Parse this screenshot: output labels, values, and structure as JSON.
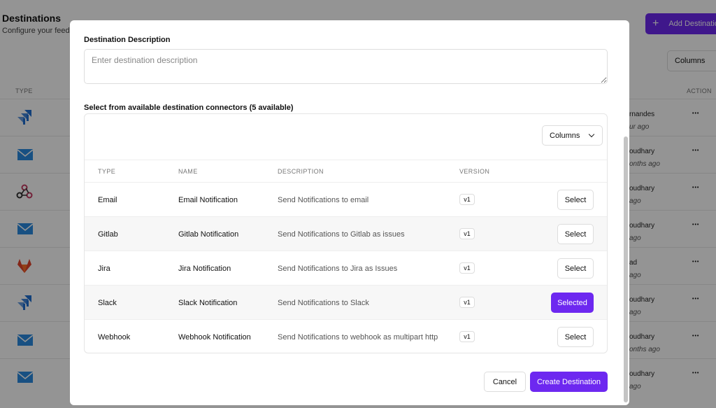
{
  "background": {
    "title": "Destinations",
    "subtitle": "Configure your feedba",
    "add_button": "Add Destinatio",
    "columns_button": "Columns",
    "col_type": "TYPE",
    "col_action": "ACTION",
    "rows": [
      {
        "icon": "jira-icon",
        "author": "rnandes",
        "ago": "ur ago"
      },
      {
        "icon": "email-icon",
        "author": "oudhary",
        "ago": "onths ago"
      },
      {
        "icon": "webhook-icon",
        "author": "oudhary",
        "ago": "ago"
      },
      {
        "icon": "email-icon",
        "author": "oudhary",
        "ago": "ago"
      },
      {
        "icon": "gitlab-icon",
        "author": "ad",
        "ago": "ago"
      },
      {
        "icon": "jira-icon",
        "author": "oudhary",
        "ago": "ago"
      },
      {
        "icon": "email-icon",
        "author": "oudhary",
        "ago": "onths ago"
      },
      {
        "icon": "email-icon",
        "author": "oudhary",
        "ago": "ago"
      }
    ]
  },
  "modal": {
    "description_label": "Destination Description",
    "description_placeholder": "Enter destination description",
    "description_value": "",
    "connectors_label": "Select from available destination connectors (5 available)",
    "columns_button": "Columns",
    "table": {
      "headers": [
        "TYPE",
        "NAME",
        "DESCRIPTION",
        "VERSION"
      ],
      "rows": [
        {
          "type": "Email",
          "name": "Email Notification",
          "description": "Send Notifications to email",
          "version": "v1",
          "action": "Select",
          "selected": false
        },
        {
          "type": "Gitlab",
          "name": "Gitlab Notification",
          "description": "Send Notifications to Gitlab as issues",
          "version": "v1",
          "action": "Select",
          "selected": false
        },
        {
          "type": "Jira",
          "name": "Jira Notification",
          "description": "Send Notifications to Jira as Issues",
          "version": "v1",
          "action": "Select",
          "selected": false
        },
        {
          "type": "Slack",
          "name": "Slack Notification",
          "description": "Send Notifications to Slack",
          "version": "v1",
          "action": "Selected",
          "selected": true
        },
        {
          "type": "Webhook",
          "name": "Webhook Notification",
          "description": "Send Notifications to webhook as multipart http",
          "version": "v1",
          "action": "Select",
          "selected": false
        }
      ]
    },
    "cancel_button": "Cancel",
    "create_button": "Create Destination"
  },
  "colors": {
    "accent": "#6d28f0",
    "jira": "#1f6fd1",
    "email": "#2a8be0",
    "gitlab": "#e2432a",
    "webhook": "#c73a63"
  }
}
